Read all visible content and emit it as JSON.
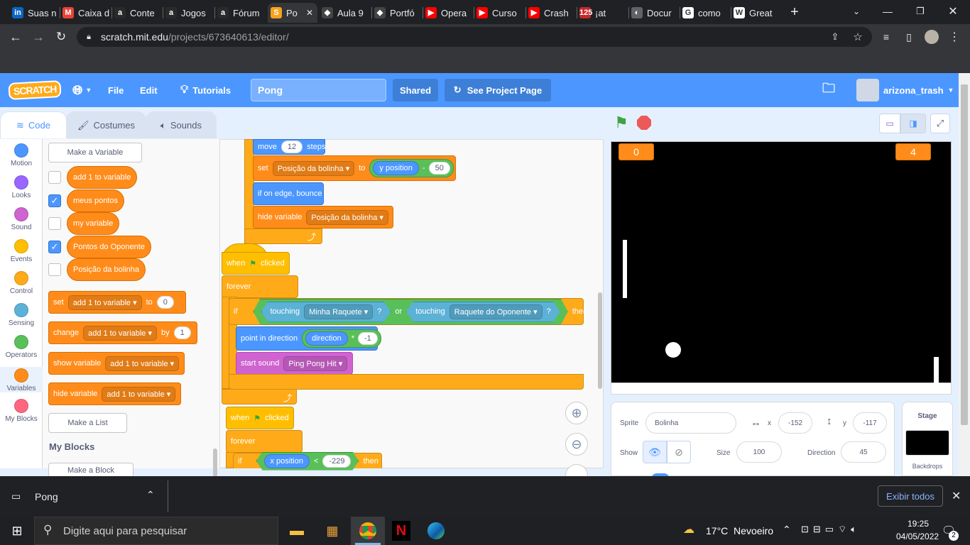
{
  "browser": {
    "tabs": [
      {
        "label": "Suas n",
        "icon": "linkedin-icon",
        "color": "#0a66c2",
        "glyph": "in"
      },
      {
        "label": "Caixa d",
        "icon": "gmail-icon",
        "color": "#ea4335",
        "glyph": "M"
      },
      {
        "label": "Conte",
        "icon": "alura-icon",
        "color": "#2a2a2a",
        "glyph": "a"
      },
      {
        "label": "Jogos",
        "icon": "alura-icon",
        "color": "#2a2a2a",
        "glyph": "a"
      },
      {
        "label": "Fórum",
        "icon": "alura-icon",
        "color": "#2a2a2a",
        "glyph": "a"
      },
      {
        "label": "Po",
        "icon": "scratch-icon",
        "color": "#f7a21b",
        "glyph": "S",
        "active": true
      },
      {
        "label": "Aula 9",
        "icon": "codepen-icon",
        "color": "#444",
        "glyph": "◆"
      },
      {
        "label": "Portfó",
        "icon": "codepen-icon",
        "color": "#444",
        "glyph": "◆"
      },
      {
        "label": "Opera",
        "icon": "youtube-icon",
        "color": "#ff0000",
        "glyph": "▶"
      },
      {
        "label": "Curso",
        "icon": "youtube-icon",
        "color": "#ff0000",
        "glyph": "▶"
      },
      {
        "label": "Crash",
        "icon": "youtube-icon",
        "color": "#ff0000",
        "glyph": "▶"
      },
      {
        "label": "¡at",
        "icon": "whatsapp-icon",
        "color": "#c62828",
        "glyph": "125"
      },
      {
        "label": "Docur",
        "icon": "globe-icon",
        "color": "#5f6368",
        "glyph": "◐"
      },
      {
        "label": "como",
        "icon": "google-icon",
        "color": "#fff",
        "glyph": "G"
      },
      {
        "label": "Great",
        "icon": "wikipedia-icon",
        "color": "#fff",
        "glyph": "W"
      }
    ],
    "url_host": "scratch.mit.edu",
    "url_path": "/projects/673640613/editor/"
  },
  "menubar": {
    "file": "File",
    "edit": "Edit",
    "tutorials": "Tutorials",
    "project_title": "Pong",
    "shared": "Shared",
    "see_project_page": "See Project Page",
    "username": "arizona_trash",
    "logo_text": "SCRATCH"
  },
  "tabs": {
    "code": "Code",
    "costumes": "Costumes",
    "sounds": "Sounds"
  },
  "categories": [
    {
      "label": "Motion",
      "color": "#4c97ff"
    },
    {
      "label": "Looks",
      "color": "#9966ff"
    },
    {
      "label": "Sound",
      "color": "#cf63cf"
    },
    {
      "label": "Events",
      "color": "#ffbf00"
    },
    {
      "label": "Control",
      "color": "#ffab19"
    },
    {
      "label": "Sensing",
      "color": "#5cb1d6"
    },
    {
      "label": "Operators",
      "color": "#59c059"
    },
    {
      "label": "Variables",
      "color": "#ff8c1a"
    },
    {
      "label": "My Blocks",
      "color": "#ff6680"
    }
  ],
  "palette": {
    "make_variable": "Make a Variable",
    "variables": [
      {
        "name": "add 1 to variable",
        "checked": false
      },
      {
        "name": "meus pontos",
        "checked": true
      },
      {
        "name": "my variable",
        "checked": false
      },
      {
        "name": "Pontos do Oponente",
        "checked": true
      },
      {
        "name": "Posição da bolinha",
        "checked": false
      }
    ],
    "set_block": {
      "op": "set",
      "var": "add 1 to variable",
      "to": "to",
      "value": "0"
    },
    "change_block": {
      "op": "change",
      "var": "add 1 to variable",
      "by": "by",
      "value": "1"
    },
    "show_block": {
      "op": "show variable",
      "var": "add 1 to variable"
    },
    "hide_block": {
      "op": "hide variable",
      "var": "add 1 to variable"
    },
    "make_list": "Make a List",
    "my_blocks_heading": "My Blocks",
    "make_block": "Make a Block"
  },
  "script": {
    "move": {
      "label": "move",
      "value": "12",
      "unit": "steps"
    },
    "set_pos": {
      "label": "set",
      "var": "Posição da bolinha",
      "to": "to",
      "reporter": "y position",
      "minus": "-",
      "value": "50"
    },
    "bounce": "if on edge, bounce",
    "hide_var": {
      "label": "hide variable",
      "var": "Posição da bolinha"
    },
    "hat1": {
      "when": "when",
      "clicked": "clicked"
    },
    "forever1": "forever",
    "if1": {
      "if": "if",
      "touching1": "touching",
      "target1": "Minha Raquete",
      "q1": "?",
      "or": "or",
      "touching2": "touching",
      "target2": "Raquete do Oponente",
      "q2": "?",
      "then": "then"
    },
    "point": {
      "label": "point in direction",
      "reporter": "direction",
      "times": "*",
      "value": "-1"
    },
    "sound": {
      "label": "start sound",
      "value": "Ping Pong Hit"
    },
    "hat2": {
      "when": "when",
      "clicked": "clicked"
    },
    "forever2": "forever",
    "if2": {
      "if": "if",
      "reporter": "x position",
      "lt": "<",
      "value": "-229",
      "then": "then"
    }
  },
  "stage": {
    "score_left": "0",
    "score_right": "4"
  },
  "sprite_info": {
    "sprite_label": "Sprite",
    "sprite_name": "Bolinha",
    "x_label": "x",
    "x": "-152",
    "y_label": "y",
    "y": "-117",
    "show_label": "Show",
    "size_label": "Size",
    "size": "100",
    "direction_label": "Direction",
    "direction": "45"
  },
  "stage_pane": {
    "title": "Stage",
    "backdrops": "Backdrops"
  },
  "download_bar": {
    "item": "Pong",
    "show_all": "Exibir todos"
  },
  "taskbar": {
    "search_placeholder": "Digite aqui para pesquisar",
    "weather": "17°C  Nevoeiro",
    "time": "19:25",
    "date": "04/05/2022",
    "notifications": "2"
  }
}
